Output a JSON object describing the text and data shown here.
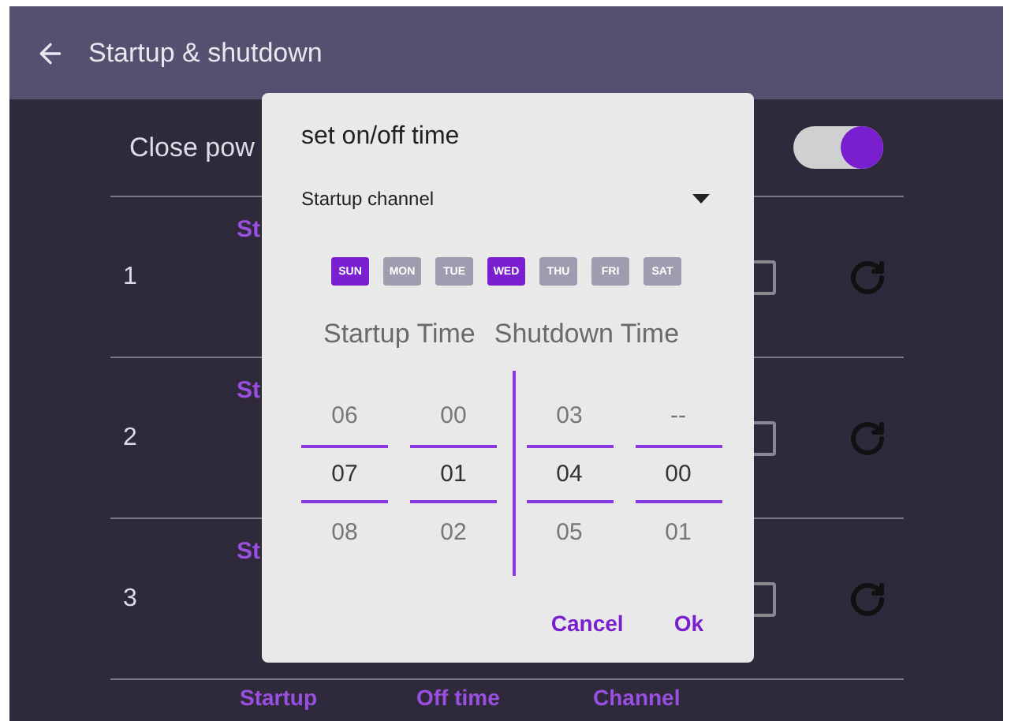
{
  "header": {
    "title": "Startup & shutdown"
  },
  "close_power": {
    "label": "Close pow",
    "on": true
  },
  "rows": [
    {
      "number": "1",
      "title": "St",
      "checked": false
    },
    {
      "number": "2",
      "title": "St",
      "checked": false
    },
    {
      "number": "3",
      "title": "St",
      "checked": false
    }
  ],
  "footer_columns": [
    "Startup",
    "Off time",
    "Channel"
  ],
  "dialog": {
    "title": "set on/off time",
    "channel": {
      "value": "Startup channel"
    },
    "days": [
      {
        "label": "SUN",
        "selected": true
      },
      {
        "label": "MON",
        "selected": false
      },
      {
        "label": "TUE",
        "selected": false
      },
      {
        "label": "WED",
        "selected": true
      },
      {
        "label": "THU",
        "selected": false
      },
      {
        "label": "FRI",
        "selected": false
      },
      {
        "label": "SAT",
        "selected": false
      }
    ],
    "headers": [
      "Startup Time",
      "Shutdown Time"
    ],
    "pickers": [
      {
        "above": "06",
        "value": "07",
        "below": "08"
      },
      {
        "above": "00",
        "value": "01",
        "below": "02"
      },
      {
        "above": "03",
        "value": "04",
        "below": "05"
      },
      {
        "above": "--",
        "value": "00",
        "below": "01"
      }
    ],
    "buttons": [
      "Cancel",
      "Ok"
    ]
  }
}
